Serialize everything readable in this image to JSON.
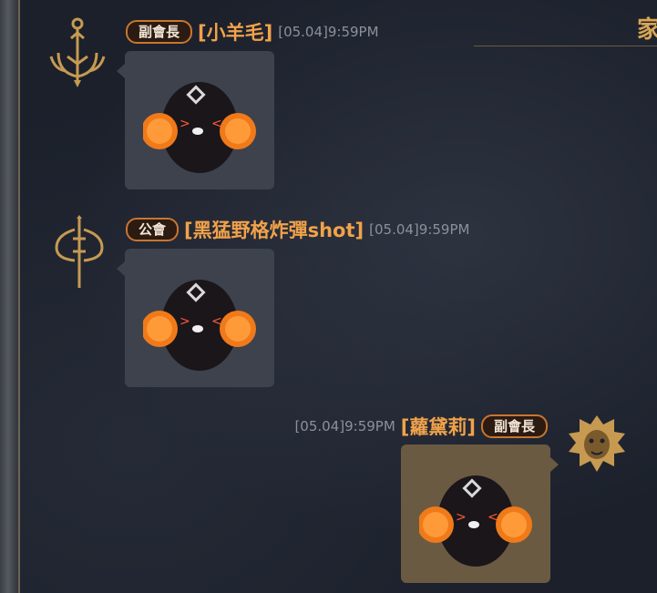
{
  "panel": {
    "title": "家"
  },
  "messages": [
    {
      "role_badge": "副會長",
      "sender": "[小羊毛]",
      "timestamp": "[05.04]9:59PM",
      "avatar_icon": "trident-emblem-icon",
      "sticker": "penguin-cheer-pompoms-sticker",
      "align": "left"
    },
    {
      "role_badge": "公會",
      "sender": "[黑猛野格炸彈shot]",
      "timestamp": "[05.04]9:59PM",
      "avatar_icon": "axe-emblem-icon",
      "sticker": "penguin-cheer-pompoms-sticker",
      "align": "left"
    },
    {
      "role_badge": "副會長",
      "sender": "[蘿黛莉]",
      "timestamp": "[05.04]9:59PM",
      "avatar_icon": "lion-head-emblem-icon",
      "sticker": "penguin-cheer-pompoms-sticker",
      "align": "right"
    }
  ],
  "colors": {
    "accent_orange": "#f1a24a",
    "badge_border": "#c9762e",
    "gold": "#d8a654",
    "background": "#1b202b"
  }
}
